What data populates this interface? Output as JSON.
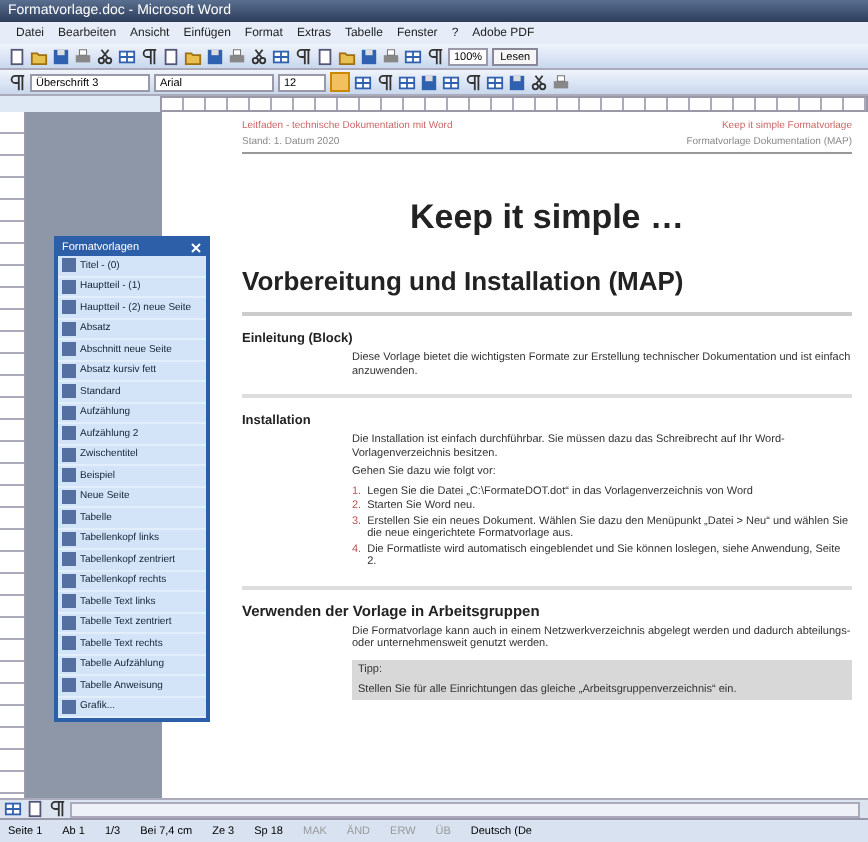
{
  "window": {
    "title": "Formatvorlage.doc - Microsoft Word"
  },
  "menu": [
    "Datei",
    "Bearbeiten",
    "Ansicht",
    "Einfügen",
    "Format",
    "Extras",
    "Tabelle",
    "Fenster",
    "?",
    "Adobe PDF"
  ],
  "toolbar": {
    "zoom": "100%",
    "read_button": "Lesen"
  },
  "format_bar": {
    "style": "Überschrift 3",
    "font": "Arial",
    "size": "12",
    "bold": true
  },
  "styles_panel": {
    "title": "Formatvorlagen",
    "items": [
      {
        "label": "Titel - (0)"
      },
      {
        "label": "Hauptteil - (1)"
      },
      {
        "label": "Hauptteil - (2) neue Seite"
      },
      {
        "label": "Absatz"
      },
      {
        "label": "Abschnitt neue Seite"
      },
      {
        "label": "Absatz kursiv fett"
      },
      {
        "label": "Standard"
      },
      {
        "label": "Aufzählung"
      },
      {
        "label": "Aufzählung 2"
      },
      {
        "label": "Zwischentitel"
      },
      {
        "label": "Beispiel"
      },
      {
        "label": "Neue Seite"
      },
      {
        "label": "Tabelle"
      },
      {
        "label": "Tabellenkopf links"
      },
      {
        "label": "Tabellenkopf zentriert"
      },
      {
        "label": "Tabellenkopf rechts"
      },
      {
        "label": "Tabelle Text links"
      },
      {
        "label": "Tabelle Text zentriert"
      },
      {
        "label": "Tabelle Text rechts"
      },
      {
        "label": "Tabelle Aufzählung"
      },
      {
        "label": "Tabelle Anweisung"
      },
      {
        "label": "Grafik..."
      }
    ]
  },
  "document": {
    "header_left": "Leitfaden - technische Dokumentation mit Word",
    "header_right": "Keep it simple Formatvorlage",
    "subheader_left": "Stand: 1. Datum 2020",
    "subheader_right": "Formatvorlage Dokumentation (MAP)",
    "title": "Keep it simple …",
    "heading": "Vorbereitung und Installation (MAP)",
    "sections": [
      {
        "title": "Einleitung (Block)",
        "paragraphs": [
          "Diese Vorlage bietet die wichtigsten Formate zur Erstellung technischer Dokumentation und ist einfach anzuwenden."
        ]
      },
      {
        "title": "Installation",
        "paragraphs": [
          "Die Installation ist einfach durchführbar. Sie müssen dazu das Schreibrecht auf Ihr Word-Vorlagenverzeichnis besitzen.",
          "Gehen Sie dazu wie folgt vor:"
        ],
        "steps": [
          {
            "number": "1.",
            "text": "Legen Sie die Datei „C:\\FormateDOT.dot“ in das Vorlagenverzeichnis von Word"
          },
          {
            "number": "2.",
            "text": "Starten Sie Word neu."
          },
          {
            "number": "3.",
            "text": "Erstellen Sie ein neues Dokument. Wählen Sie dazu den Menüpunkt „Datei > Neu“ und wählen Sie die neue eingerichtete Formatvorlage aus."
          },
          {
            "number": "4.",
            "text": "Die Formatliste wird automatisch eingeblendet und Sie können loslegen, siehe Anwendung, Seite 2."
          }
        ]
      }
    ],
    "group_heading": "Verwenden der Vorlage in Arbeitsgruppen",
    "group_text": "Die Formatvorlage kann auch in einem Netzwerkverzeichnis abgelegt werden und dadurch abteilungs- oder unternehmensweit genutzt werden.",
    "tip_label": "Tipp:",
    "tip_text": "Stellen Sie für alle Einrichtungen das gleiche „Arbeitsgruppenverzeichnis“ ein."
  },
  "status_bar": [
    {
      "text": "Seite 1",
      "disabled": false
    },
    {
      "text": "Ab 1",
      "disabled": false
    },
    {
      "text": "1/3",
      "disabled": false
    },
    {
      "text": "Bei 7,4 cm",
      "disabled": false
    },
    {
      "text": "Ze 3",
      "disabled": false
    },
    {
      "text": "Sp 18",
      "disabled": false
    },
    {
      "text": "MAK",
      "disabled": true
    },
    {
      "text": "ÄND",
      "disabled": true
    },
    {
      "text": "ERW",
      "disabled": true
    },
    {
      "text": "ÜB",
      "disabled": true
    },
    {
      "text": "Deutsch (De",
      "disabled": false
    }
  ]
}
